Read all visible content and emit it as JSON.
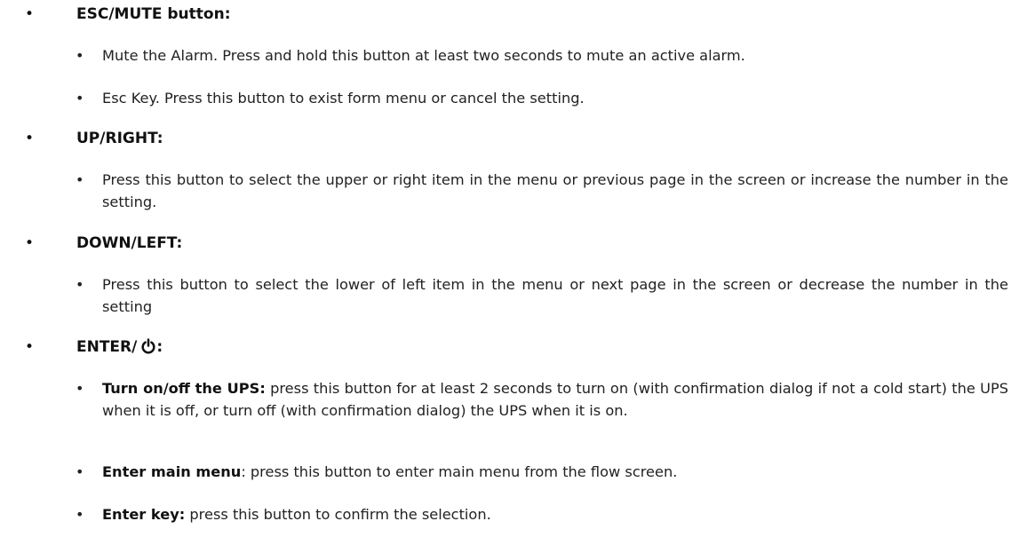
{
  "bullet_char": "•",
  "sections": {
    "esc": {
      "heading": "ESC/MUTE button:",
      "items": [
        "Mute the Alarm. Press and hold this button at least two seconds to mute an active alarm.",
        "Esc Key. Press this button to exist form menu or cancel the setting."
      ]
    },
    "up": {
      "heading": "UP/RIGHT:",
      "items": [
        "Press this button to select the upper or right item in the menu or previous page in the screen or increase the number in the setting."
      ]
    },
    "down": {
      "heading": "DOWN/LEFT:",
      "items": [
        "Press this button to select the lower of left item in the menu or next page in the screen or decrease the number in the setting"
      ]
    },
    "enter": {
      "heading_prefix": "ENTER/",
      "heading_icon": "power-icon",
      "heading_suffix": ":",
      "items": [
        {
          "label": "Turn on/off the UPS:",
          "text": " press this button for at least 2 seconds to turn on (with confirmation dialog if not a cold start) the UPS when it is off, or turn off (with confirmation dialog) the UPS when it is on."
        },
        {
          "label": "Enter main menu",
          "text": ": press this button to enter main menu from the flow screen."
        },
        {
          "label": "Enter key:",
          "text": " press this button to confirm the selection."
        }
      ]
    }
  }
}
